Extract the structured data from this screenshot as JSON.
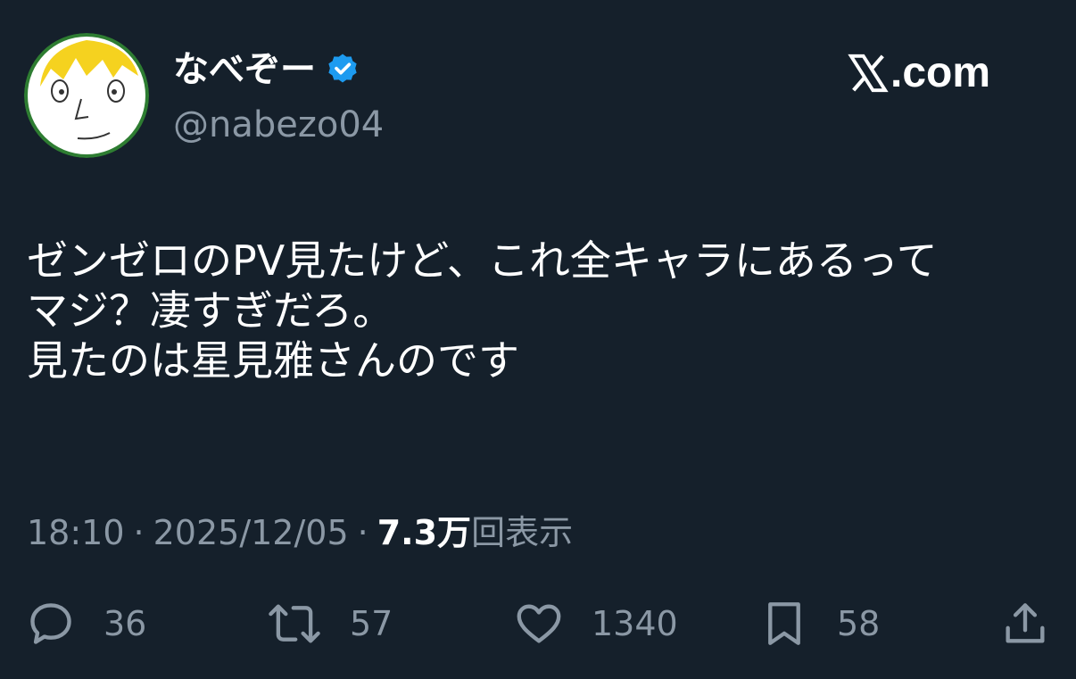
{
  "user": {
    "display_name": "なべぞー",
    "handle": "@nabezo04",
    "verified_icon": "verified-badge-icon"
  },
  "site": {
    "label": ".com",
    "logo_icon": "x-logo-icon"
  },
  "tweet": {
    "lines": [
      "ゼンゼロのPV見たけど、これ全キャラにあるって",
      "マジ？凄すぎだろ。",
      "見たのは星見雅さんのです"
    ]
  },
  "meta": {
    "time": "18:10",
    "separator": "·",
    "date": "2025/12/05",
    "views_count": "7.3万",
    "views_label": "回表示"
  },
  "actions": {
    "replies": "36",
    "retweets": "57",
    "likes": "1340",
    "bookmarks": "58"
  },
  "colors": {
    "background": "#15202b",
    "secondary_text": "#8b98a5",
    "verified_blue": "#1d9bf0"
  }
}
